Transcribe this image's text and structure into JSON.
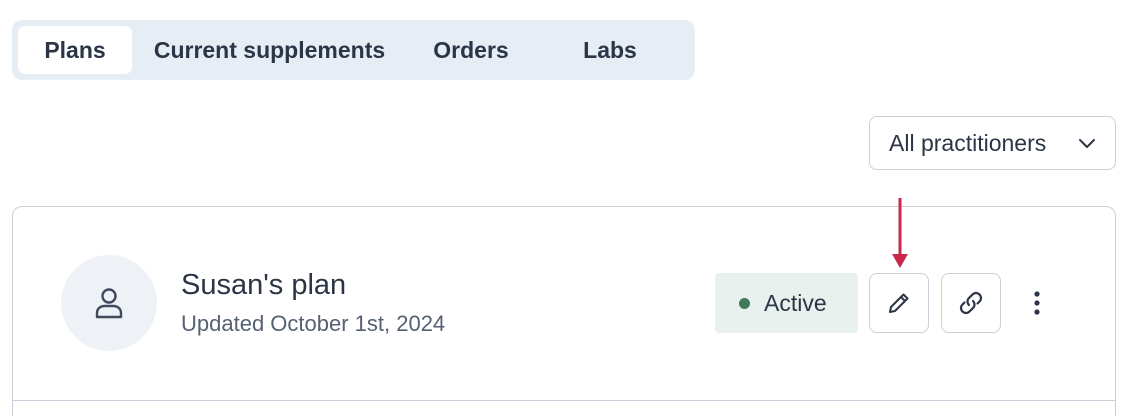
{
  "tabs": [
    {
      "label": "Plans",
      "selected": true
    },
    {
      "label": "Current supplements",
      "selected": false
    },
    {
      "label": "Orders",
      "selected": false
    },
    {
      "label": "Labs",
      "selected": false
    }
  ],
  "practitioner_filter": {
    "selected": "All practitioners",
    "icon": "chevron-down-icon"
  },
  "plan": {
    "title": "Susan's plan",
    "updated": "Updated October 1st, 2024",
    "avatar_icon": "user-icon",
    "status": {
      "label": "Active",
      "color": "#3d7a5a",
      "background": "#e9f1ee"
    },
    "actions": {
      "edit_icon": "pencil-icon",
      "link_icon": "link-icon",
      "more_icon": "more-vertical-icon"
    }
  },
  "annotation": {
    "color": "#c8294a",
    "points_to": "edit-button"
  }
}
